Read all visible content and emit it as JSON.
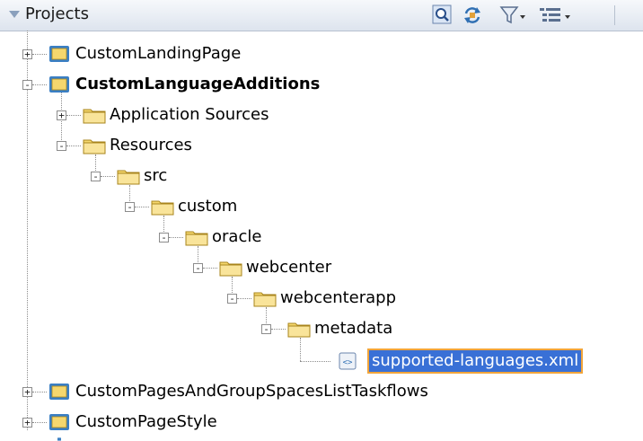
{
  "panel": {
    "title": "Projects",
    "toolbar": [
      {
        "name": "search-icon"
      },
      {
        "name": "sync-icon"
      },
      {
        "name": "filter-icon"
      },
      {
        "name": "view-options-icon"
      }
    ]
  },
  "tree": {
    "nodes": [
      {
        "label": "CustomLandingPage",
        "toggle": "+",
        "icon": "project-icon",
        "bold": false
      },
      {
        "label": "CustomLanguageAdditions",
        "toggle": "-",
        "icon": "project-icon",
        "bold": true
      },
      {
        "label": "Application Sources",
        "toggle": "+",
        "icon": "folder-icon"
      },
      {
        "label": "Resources",
        "toggle": "-",
        "icon": "folder-icon"
      },
      {
        "label": "src",
        "toggle": "-",
        "icon": "folder-icon"
      },
      {
        "label": "custom",
        "toggle": "-",
        "icon": "folder-icon"
      },
      {
        "label": "oracle",
        "toggle": "-",
        "icon": "folder-icon"
      },
      {
        "label": "webcenter",
        "toggle": "-",
        "icon": "folder-icon"
      },
      {
        "label": "webcenterapp",
        "toggle": "-",
        "icon": "folder-icon"
      },
      {
        "label": "metadata",
        "toggle": "-",
        "icon": "folder-icon"
      },
      {
        "label": "supported-languages.xml",
        "toggle": "",
        "icon": "xml-file-icon",
        "selected": true
      },
      {
        "label": "CustomPagesAndGroupSpacesListTaskflows",
        "toggle": "+",
        "icon": "project-icon"
      },
      {
        "label": "CustomPageStyle",
        "toggle": "+",
        "icon": "project-icon"
      }
    ]
  },
  "colors": {
    "selection_bg": "#3970d6",
    "selection_outline": "#f2a53a",
    "folder": "#f5d76e",
    "project_frame": "#3a7fc4"
  }
}
